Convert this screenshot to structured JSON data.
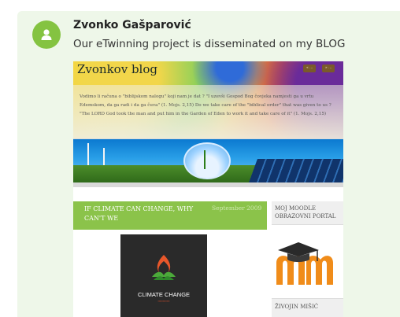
{
  "post": {
    "author": "Zvonko Gašparović",
    "message": "Our eTwinning project is disseminated on my BLOG"
  },
  "blog": {
    "title": "Zvonkov blog",
    "header_buttons": [
      "« ...",
      "» ..."
    ],
    "quote": "Vodimo li računa o \"biblijskom nalogu\" koji nam je dat ? \"I uzevši Gospod Bog čovjeka namjesti ga u vrtu Edemskom, da ga radi i da ga čuva\" (1. Mojs. 2,15) Do we take care of the \"biblical order\" that was given to us ? \"The LORD God took the man and put him in the Garden of Eden to work it and take care of it\" (1. Mojs. 2,15)",
    "post_title": "IF CLIMATE CAN CHANGE, WHY CAN'T WE",
    "post_date": "September 2009",
    "sidebar_title": "MOJ MOODLE OBRAZOVNI PORTAL",
    "sidebar_title2": "ŽIVOJIN MIŠIĆ",
    "climate_label": "CLIMATE CHANGE"
  },
  "colors": {
    "card_bg": "#eef7e9",
    "avatar": "#84c341",
    "post_head": "#8bc34a"
  },
  "icons": {
    "avatar": "user-icon"
  }
}
